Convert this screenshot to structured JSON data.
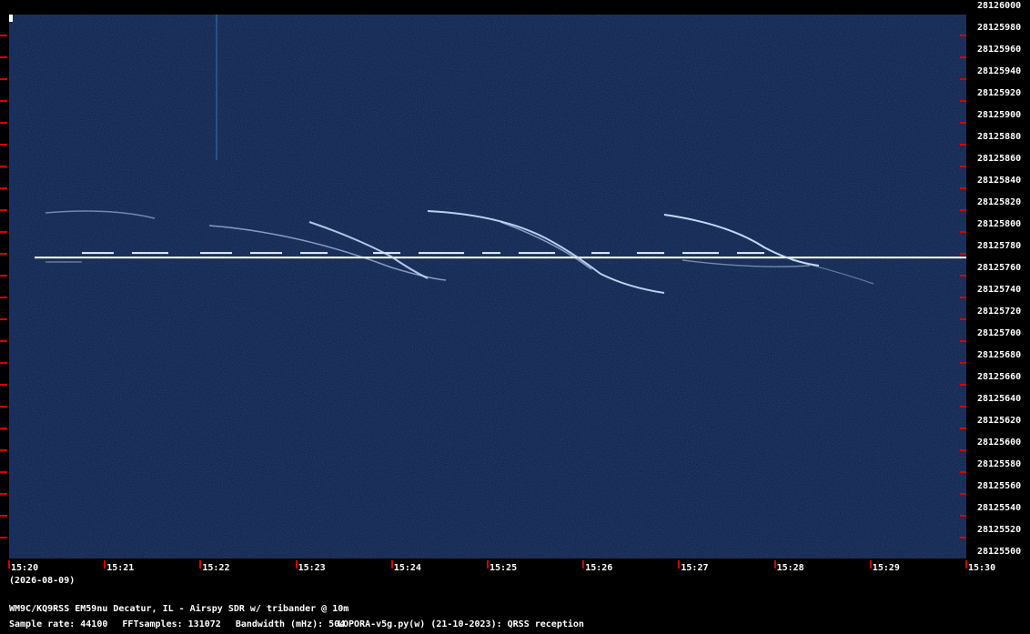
{
  "chart_data": {
    "type": "heatmap",
    "freq_labels": [
      "28126000",
      "28125980",
      "28125960",
      "28125940",
      "28125920",
      "28125900",
      "28125880",
      "28125860",
      "28125840",
      "28125820",
      "28125800",
      "28125780",
      "28125760",
      "28125740",
      "28125720",
      "28125700",
      "28125680",
      "28125660",
      "28125640",
      "28125620",
      "28125600",
      "28125580",
      "28125560",
      "28125540",
      "28125520",
      "28125500"
    ],
    "time_labels": [
      "15:20",
      "15:21",
      "15:22",
      "15:23",
      "15:24",
      "15:25",
      "15:26",
      "15:27",
      "15:28",
      "15:29",
      "15:30"
    ],
    "carrier_freq_hz": 28125774,
    "colors": {
      "background": "#0a1c44",
      "signal": "#ffffff",
      "tick": "#dd0000"
    }
  },
  "date_label": "(2026-08-09)",
  "footer": {
    "station": "WM9C/KQ9RSS EM59nu Decatur, IL - Airspy SDR w/ tribander @ 10m",
    "sample_rate": "Sample rate: 44100",
    "fft_samples": "FFTsamples: 131072",
    "bandwidth": "Bandwidth (mHz): 504",
    "software": "LOPORA-v5g.py(w) (21-10-2023): QRSS reception"
  }
}
